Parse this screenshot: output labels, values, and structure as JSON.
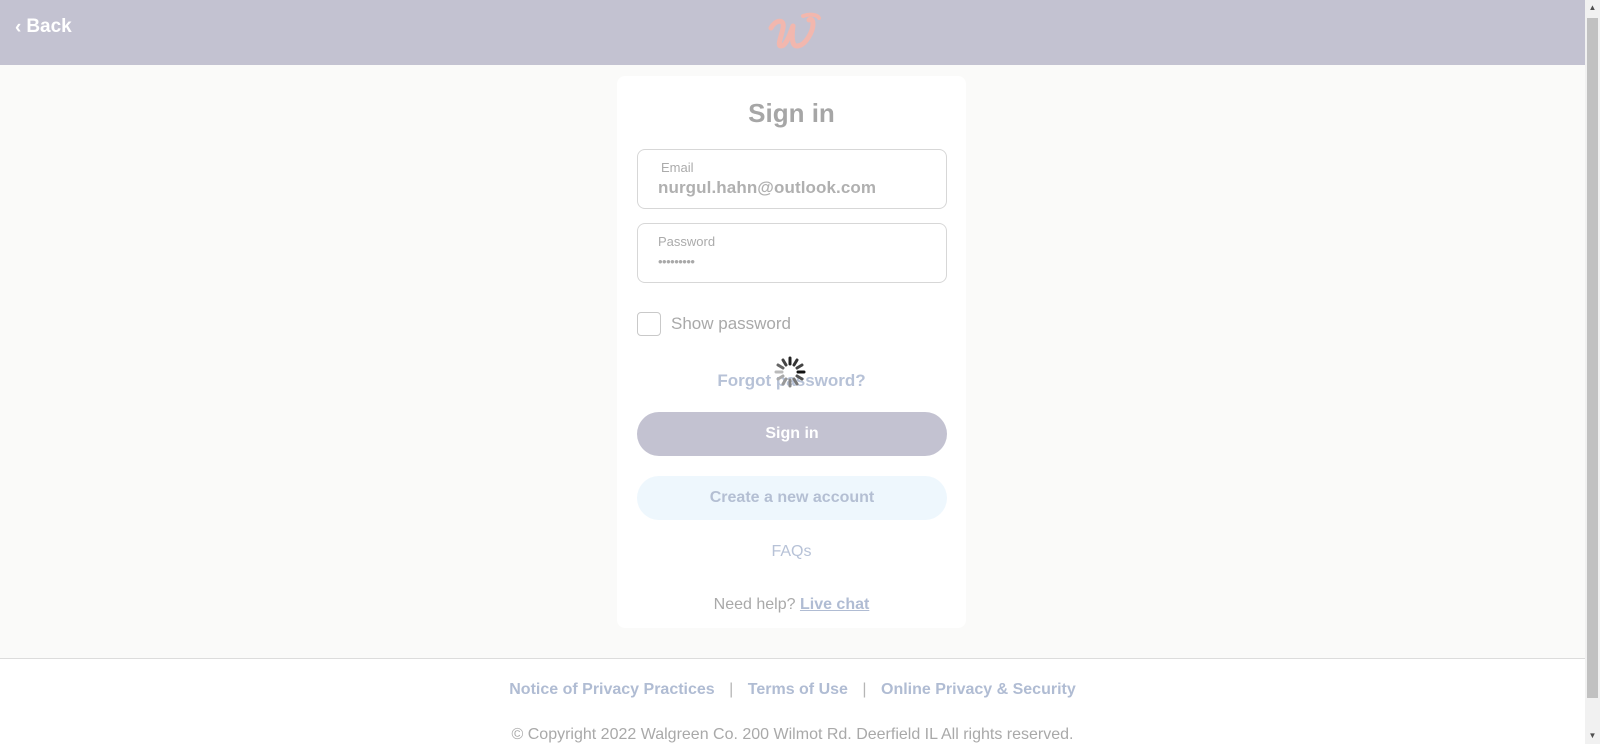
{
  "header": {
    "back_label": "Back",
    "logo_name": "walgreens-w-logo"
  },
  "card": {
    "title": "Sign in",
    "email": {
      "label": "Email",
      "value": "nurgul.hahn@outlook.com"
    },
    "password": {
      "label": "Password",
      "value": "•••••••••"
    },
    "show_password_label": "Show password",
    "forgot_label": "Forgot password?",
    "sign_in_label": "Sign in",
    "create_account_label": "Create a new account",
    "faqs_label": "FAQs",
    "help_text": "Need help?",
    "live_chat_label": "Live chat"
  },
  "footer": {
    "links": [
      "Notice of Privacy Practices",
      "Terms of Use",
      "Online Privacy & Security"
    ],
    "separator": "|",
    "copyright": "© Copyright 2022 Walgreen Co. 200 Wilmot Rd. Deerfield IL All rights reserved."
  },
  "colors": {
    "header_bg": "#c3c2d1",
    "logo": "#f2b7ae",
    "link": "#b0bcd3",
    "secondary_button_bg": "#eef7fd"
  },
  "status": {
    "loading": true
  }
}
